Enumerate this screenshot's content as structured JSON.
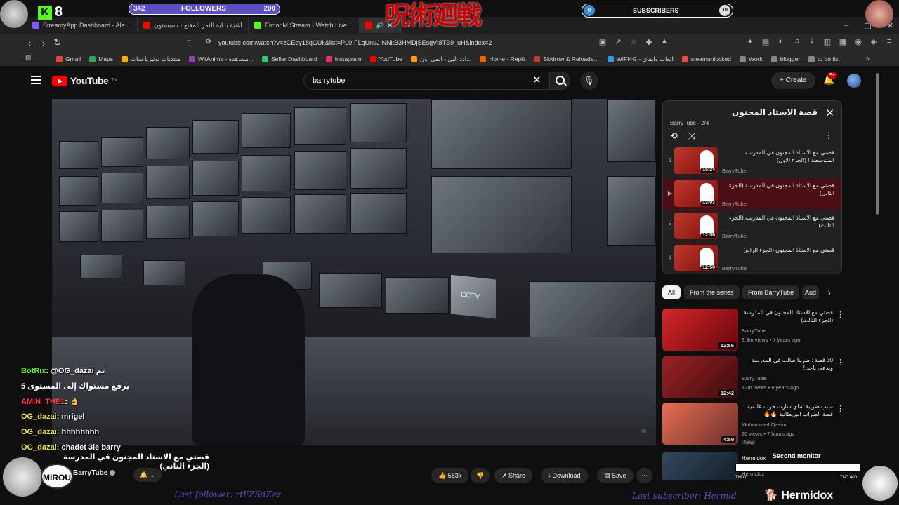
{
  "browser": {
    "tabs": [
      {
        "title": "StreamyApp Dashboard - Alert Confi",
        "color": "#7b5cf5"
      },
      {
        "title": "أغنية بداية الثمر المقنع - سبيستون",
        "color": "#ff0000"
      },
      {
        "title": "EimonM Stream - Watch Live on",
        "color": "#53fc18"
      },
      {
        "title": "",
        "color": "#ff0000"
      }
    ],
    "window_controls": [
      "–",
      "▢",
      "✕"
    ],
    "url": "youtube.com/watch?v=zCEey18qGUk&list=PL0-FLqUnuJ-NNkB3HMDjSEsgVt8TB9_uH&index=2",
    "bookmarks": [
      {
        "label": "Gmail",
        "color": "#ea4335"
      },
      {
        "label": "Maps",
        "color": "#34a853"
      },
      {
        "label": "منتديات تونيزيا سات",
        "color": "#f4b400"
      },
      {
        "label": "WitAnime - مشاهدة...",
        "color": "#8e44ad"
      },
      {
        "label": "Seller Dashboard",
        "color": "#2ecc71"
      },
      {
        "label": "Instagram",
        "color": "#e1306c"
      },
      {
        "label": "YouTube",
        "color": "#ff0000"
      },
      {
        "label": "ادد البي - انمي اون...",
        "color": "#f39c12"
      },
      {
        "label": "Home - Replit",
        "color": "#f26207"
      },
      {
        "label": "Skidrow & Reloade...",
        "color": "#c0392b"
      },
      {
        "label": "WIFI4G - العاب وايفاي",
        "color": "#3498db"
      },
      {
        "label": "steamunlocked",
        "color": "#e74c3c"
      },
      {
        "label": "Work",
        "color": "#888888"
      },
      {
        "label": "blogger",
        "color": "#888888"
      },
      {
        "label": "to do list",
        "color": "#888888"
      }
    ]
  },
  "youtube": {
    "logo_text": "YouTube",
    "logo_tn": "TN",
    "search_value": "barrytube",
    "create_label": "+ Create",
    "notif_badge": "9+"
  },
  "video": {
    "screen_label": "CCTV",
    "title": "قصتي مع الاستاذ المجنون في المدرسة (الجزء الثاني)",
    "channel": "BarryTube",
    "likes": "583k",
    "share": "Share",
    "download": "Download",
    "save": "Save"
  },
  "playlist": {
    "title": "قصة الاستاذ المجنون",
    "meta": "BarryTube - 2/4",
    "items": [
      {
        "index": "1",
        "title": "قصتي مع الاستاذ المجنون في المدرسة المتوسطة ! (الجزء الاول)",
        "channel": "BarryTube",
        "duration": "15:24",
        "active": false
      },
      {
        "index": "▶",
        "title": "قصتي مع الاستاذ المجنون في المدرسة (الجزء الثاني)",
        "channel": "BarryTube",
        "duration": "13:03",
        "active": true
      },
      {
        "index": "3",
        "title": "قصتي مع الاستاذ المجنون في المدرسة (الجزء الثالث)",
        "channel": "BarryTube",
        "duration": "12:56",
        "active": false
      },
      {
        "index": "4",
        "title": "قصتي مع الاستاذ المجنون (الجزء الرابع)",
        "channel": "BarryTube",
        "duration": "12:50",
        "active": false
      }
    ]
  },
  "chips": [
    "All",
    "From the series",
    "From BarryTube",
    "Aud"
  ],
  "recommendations": [
    {
      "title": "قصتي مع الاستاذ المجنون في المدرسة (الجزء الثالث)",
      "channel": "BarryTube",
      "views": "9.3m views • 7 years ago",
      "duration": "12:56",
      "new": "",
      "color": "#b22222"
    },
    {
      "title": "30 قصة : ضربنا طالب في المدرسة ويدعى باحد !",
      "channel": "BarryTube",
      "views": "12m views • 6 years ago",
      "duration": "12:42",
      "new": "",
      "color": "#8b1a1a"
    },
    {
      "title": "سبب ضريبة شاي سارت حرب عالمية.. قصة الضراب البريطانية 🔥🔥",
      "channel": "Mohammed Qasim",
      "views": "20 views • 7 hours ago",
      "duration": "4:59",
      "new": "New",
      "color": "#c0392b"
    },
    {
      "title": "Hermidox",
      "channel": "Hermidox",
      "views": "",
      "duration": "",
      "new": "",
      "color": "#2c3e50"
    }
  ],
  "overlay": {
    "kick_count": "8",
    "followers_start": "342",
    "followers_label": "FOLLOWERS",
    "followers_goal": "200",
    "jjk_logo": "呪術廻戦",
    "subs_start": "0",
    "subs_label": "SUBSCRIBERS",
    "subs_end": "10",
    "chat": [
      {
        "user": "BotRix",
        "msg": ": @OG_dazai تم",
        "color": "green"
      },
      {
        "user": "",
        "msg": "يرفع مستواك إلى المستوى 5",
        "color": "green"
      },
      {
        "user": "AMIN_THE1",
        "msg": ": 👌",
        "color": "red"
      },
      {
        "user": "OG_dazai",
        "msg": ": mrigel",
        "color": "yellow"
      },
      {
        "user": "OG_dazai",
        "msg": ": hhhhhhhh",
        "color": "yellow"
      },
      {
        "user": "OG_dazai",
        "msg": ": chadet 3le barry",
        "color": "yellow"
      }
    ],
    "avatar_label": "MIROU",
    "last_follower": "Last follower: rtFZSdZez",
    "last_sub": "Last subscriber: Hermid",
    "brand": "🐕 Hermidox",
    "second_monitor": "Second monitor",
    "goal_start": "TND 0",
    "goal_end": "TND 400"
  }
}
